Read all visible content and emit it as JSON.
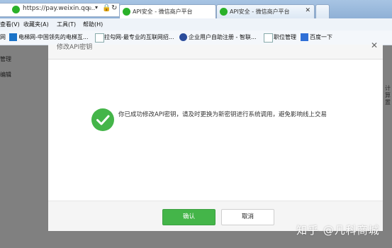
{
  "browser": {
    "address": "https://pay.weixin.qq...",
    "tabs": [
      {
        "label": "API安全 - 微信商户平台",
        "active": true
      },
      {
        "label": "API安全 - 微信商户平台",
        "active": false
      }
    ],
    "menu": [
      "查看(V)",
      "收藏夹(A)",
      "工具(T)",
      "帮助(H)"
    ],
    "favorites": [
      {
        "label": "网",
        "icon": "bookmark-icon"
      },
      {
        "label": "电梯网-中国领先的电梯互...",
        "icon": "elevator-site-icon"
      },
      {
        "label": "拉勾网-最专业的互联网招...",
        "icon": "page-icon"
      },
      {
        "label": "企业用户自助注册 - 智联...",
        "icon": "globe-icon"
      },
      {
        "label": "职位管理",
        "icon": "page-icon"
      },
      {
        "label": "百度一下",
        "icon": "baidu-icon"
      }
    ]
  },
  "background_page": {
    "side_items": [
      "管理",
      "编辑"
    ]
  },
  "dialog": {
    "title": "修改API密钥",
    "message": "你已成功修改API密钥，请及时更换为新密钥进行系统调用，避免影响线上交易",
    "confirm_label": "确认",
    "cancel_label": "取消",
    "icon": "success-check-icon"
  },
  "watermark": "知乎 @几科商城",
  "colors": {
    "success": "#44b549",
    "overlay": "rgba(0,0,0,0.45)"
  }
}
